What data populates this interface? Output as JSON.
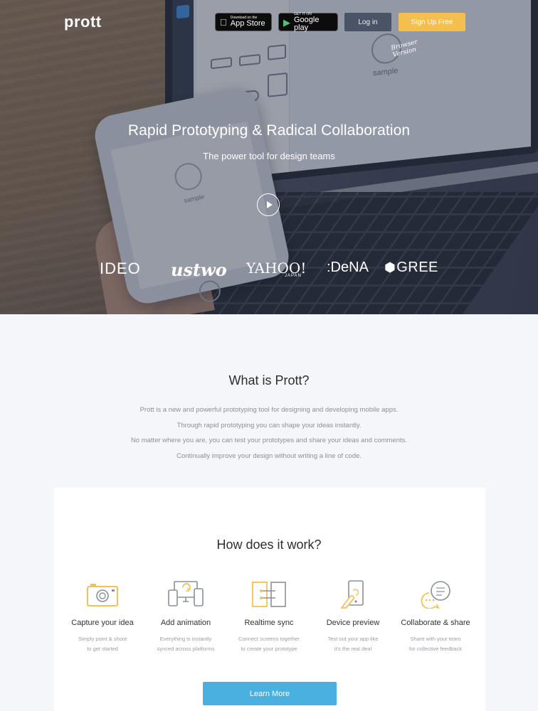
{
  "header": {
    "logo": "prott",
    "app_store": {
      "small": "Download on the",
      "big": "App Store"
    },
    "google_play": {
      "small": "GET IT ON",
      "big": "Google play"
    },
    "login_label": "Log in",
    "signup_label": "Sign Up Free",
    "browser_note": "Browser Version"
  },
  "hero": {
    "title": "Rapid Prototyping & Radical Collaboration",
    "subtitle": "The power tool for design teams",
    "screen_sample_label": "sample",
    "phone_sample_label": "sample",
    "clients": [
      "IDEO",
      "ustwo",
      "YAHOO!",
      "JAPAN",
      ":DeNA",
      "GREE"
    ]
  },
  "what": {
    "title": "What is Prott?",
    "lines": [
      "Prott is a new and powerful prototyping tool for designing and developing mobile apps.",
      "Through rapid prototyping you can shape your ideas instantly.",
      "No matter where you are, you can test your prototypes and share your ideas and comments.",
      "Continually improve your design without writing a line of code."
    ]
  },
  "how": {
    "title": "How does it work?",
    "steps": [
      {
        "icon": "camera-icon",
        "title": "Capture your idea",
        "desc1": "Simply point & shoot",
        "desc2": "to get started"
      },
      {
        "icon": "devices-sync-icon",
        "title": "Add animation",
        "desc1": "Everything is instantly",
        "desc2": "synced across platforms"
      },
      {
        "icon": "screens-link-icon",
        "title": "Realtime sync",
        "desc1": "Connect screens together",
        "desc2": "to create your prototype"
      },
      {
        "icon": "phone-touch-icon",
        "title": "Device preview",
        "desc1": "Test out your app like",
        "desc2": "it's the real deal"
      },
      {
        "icon": "chat-bubbles-icon",
        "title": "Collaborate & share",
        "desc1": "Share with your team",
        "desc2": "for collective feedback"
      }
    ],
    "learn_more_label": "Learn More"
  },
  "colors": {
    "accent_yellow": "#f4bf4f",
    "learn_blue": "#4ab0e0",
    "icon_yellow": "#f0c35a"
  }
}
